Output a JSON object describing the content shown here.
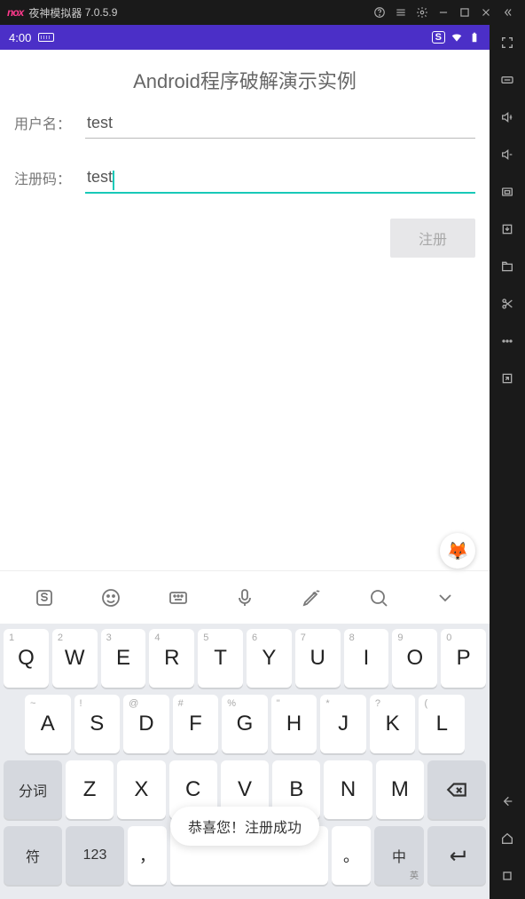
{
  "emulator": {
    "brand": "nox",
    "name": "夜神模拟器",
    "version": "7.0.5.9"
  },
  "status": {
    "time": "4:00"
  },
  "app": {
    "title": "Android程序破解演示实例",
    "username_label": "用户名：",
    "username_value": "test",
    "regcode_label": "注册码：",
    "regcode_value": "test",
    "register_btn": "注册"
  },
  "toast": "恭喜您！注册成功",
  "keyboard": {
    "row1": [
      {
        "sup": "1",
        "main": "Q"
      },
      {
        "sup": "2",
        "main": "W"
      },
      {
        "sup": "3",
        "main": "E"
      },
      {
        "sup": "4",
        "main": "R"
      },
      {
        "sup": "5",
        "main": "T"
      },
      {
        "sup": "6",
        "main": "Y"
      },
      {
        "sup": "7",
        "main": "U"
      },
      {
        "sup": "8",
        "main": "I"
      },
      {
        "sup": "9",
        "main": "O"
      },
      {
        "sup": "0",
        "main": "P"
      }
    ],
    "row2": [
      {
        "sup": "~",
        "main": "A"
      },
      {
        "sup": "!",
        "main": "S"
      },
      {
        "sup": "@",
        "main": "D"
      },
      {
        "sup": "#",
        "main": "F"
      },
      {
        "sup": "%",
        "main": "G"
      },
      {
        "sup": "\"",
        "main": "H"
      },
      {
        "sup": "*",
        "main": "J"
      },
      {
        "sup": "?",
        "main": "K"
      },
      {
        "sup": "(",
        "main": "L"
      }
    ],
    "row3": [
      {
        "main": "Z"
      },
      {
        "main": "X"
      },
      {
        "main": "C"
      },
      {
        "main": "V"
      },
      {
        "main": "B"
      },
      {
        "main": "N"
      },
      {
        "main": "M"
      }
    ],
    "fn": {
      "fenci": "分词",
      "symbol": "符",
      "num": "123",
      "comma": "，",
      "lang_main": "中",
      "lang_sub": "英",
      "period": "。"
    }
  }
}
